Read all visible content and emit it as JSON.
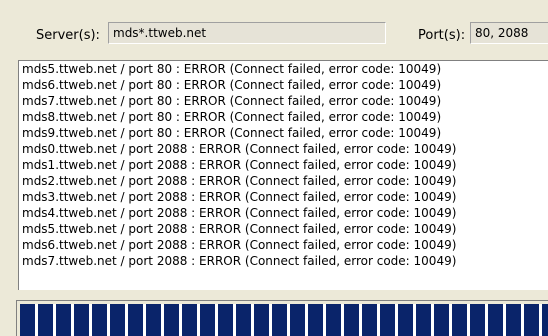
{
  "server": {
    "label": "Server(s):",
    "value": "mds*.ttweb.net"
  },
  "port": {
    "label": "Port(s):",
    "value": "80, 2088"
  },
  "log": {
    "lines": [
      "mds5.ttweb.net / port 80 : ERROR (Connect failed, error code: 10049)",
      "mds6.ttweb.net / port 80 : ERROR (Connect failed, error code: 10049)",
      "mds7.ttweb.net / port 80 : ERROR (Connect failed, error code: 10049)",
      "mds8.ttweb.net / port 80 : ERROR (Connect failed, error code: 10049)",
      "mds9.ttweb.net / port 80 : ERROR (Connect failed, error code: 10049)",
      "mds0.ttweb.net / port 2088 : ERROR (Connect failed, error code: 10049)",
      "mds1.ttweb.net / port 2088 : ERROR (Connect failed, error code: 10049)",
      "mds2.ttweb.net / port 2088 : ERROR (Connect failed, error code: 10049)",
      "mds3.ttweb.net / port 2088 : ERROR (Connect failed, error code: 10049)",
      "mds4.ttweb.net / port 2088 : ERROR (Connect failed, error code: 10049)",
      "mds5.ttweb.net / port 2088 : ERROR (Connect failed, error code: 10049)",
      "mds6.ttweb.net / port 2088 : ERROR (Connect failed, error code: 10049)",
      "mds7.ttweb.net / port 2088 : ERROR (Connect failed, error code: 10049)"
    ]
  },
  "progress": {
    "fraction": 1.0,
    "accent_color": "#0a246a"
  }
}
